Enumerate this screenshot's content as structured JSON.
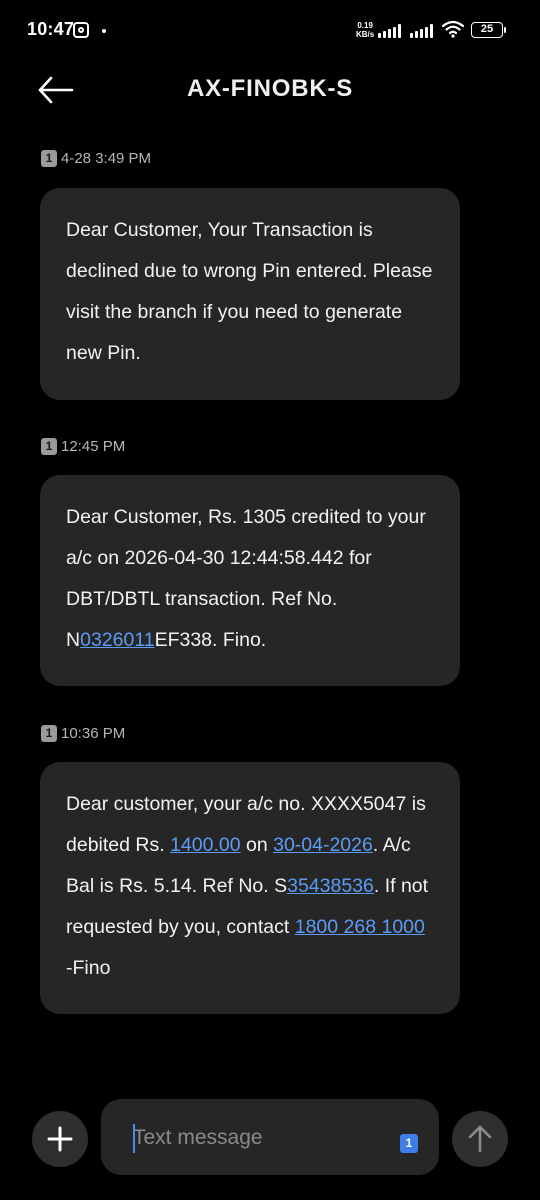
{
  "status_bar": {
    "time": "10:47",
    "net_speed_value": "0.19",
    "net_speed_unit": "KB/s",
    "battery": "25"
  },
  "header": {
    "title": "AX-FINOBK-S"
  },
  "messages": [
    {
      "sim": "1",
      "timestamp": "4-28 3:49 PM",
      "text": "Dear Customer, Your Transaction is declined due to wrong Pin entered. Please visit the branch if you need to generate new Pin."
    },
    {
      "sim": "1",
      "timestamp": "12:45 PM",
      "text_parts": [
        "Dear Customer, Rs. 1305 credited to your a/c on 2026-04-30 12:44:58.442 for DBT/DBTL transaction. Ref No. N",
        "0326011",
        "EF338. Fino."
      ]
    },
    {
      "sim": "1",
      "timestamp": "10:36 PM",
      "text_parts": [
        "Dear customer, your a/c no. XXXX5047 is debited Rs. ",
        "1400.00",
        " on ",
        "30-04-2026",
        ". A/c Bal is Rs. 5.14. Ref No. S",
        "35438536",
        ". If not requested by you, contact ",
        "1800 268 1000",
        " -Fino"
      ]
    }
  ],
  "composer": {
    "placeholder": "Text message",
    "sim": "1"
  },
  "icons": {
    "back": "arrow-left-icon",
    "add": "plus-icon",
    "send": "arrow-up-icon",
    "instagram": "instagram-icon",
    "wifi": "wifi-icon",
    "signal": "signal-icon",
    "battery": "battery-icon"
  },
  "colors": {
    "background": "#000000",
    "bubble": "#262626",
    "link": "#5b9cf6",
    "accent": "#3d7fe6"
  }
}
